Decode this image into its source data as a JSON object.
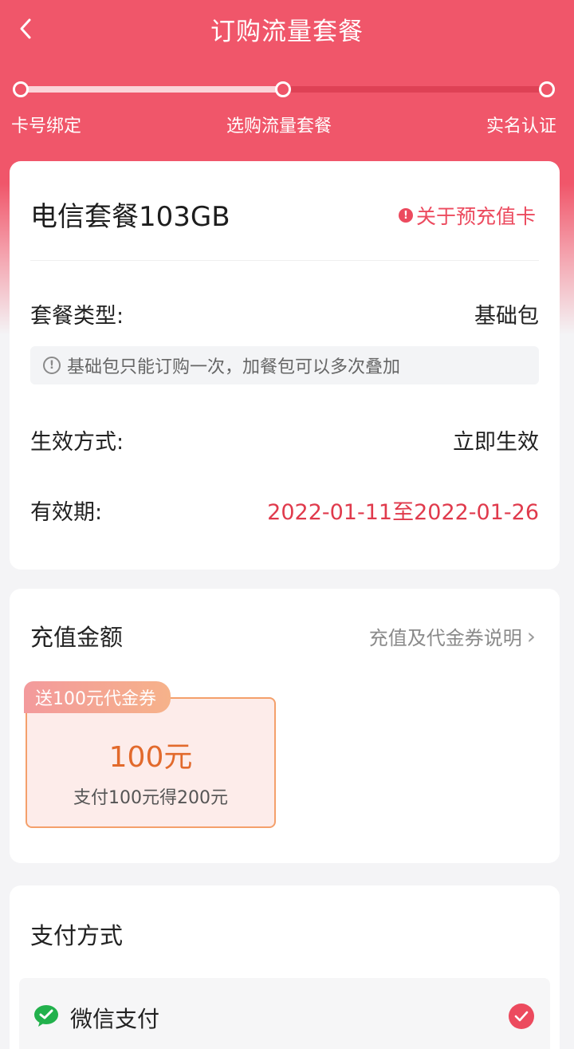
{
  "nav": {
    "title": "订购流量套餐"
  },
  "steps": [
    {
      "label": "卡号绑定"
    },
    {
      "label": "选购流量套餐"
    },
    {
      "label": "实名认证"
    }
  ],
  "steps_progress": 0.5,
  "package": {
    "title": "电信套餐103GB",
    "prepaid_link": "关于预充值卡",
    "type_label": "套餐类型:",
    "type_value": "基础包",
    "notice": "基础包只能订购一次，加餐包可以多次叠加",
    "effect_label": "生效方式:",
    "effect_value": "立即生效",
    "validity_label": "有效期:",
    "validity_value": "2022-01-11至2022-01-26"
  },
  "recharge": {
    "title": "充值金额",
    "explain_link": "充值及代金券说明",
    "coupon_tag": "送100元代金券",
    "amount": "100元",
    "amount_desc": "支付100元得200元"
  },
  "payment": {
    "title": "支付方式",
    "method": "微信支付"
  },
  "colors": {
    "brand": "#f0566a",
    "accent_red": "#e03a4c",
    "amount_orange": "#e26a2c",
    "wechat_green": "#22b14c"
  }
}
